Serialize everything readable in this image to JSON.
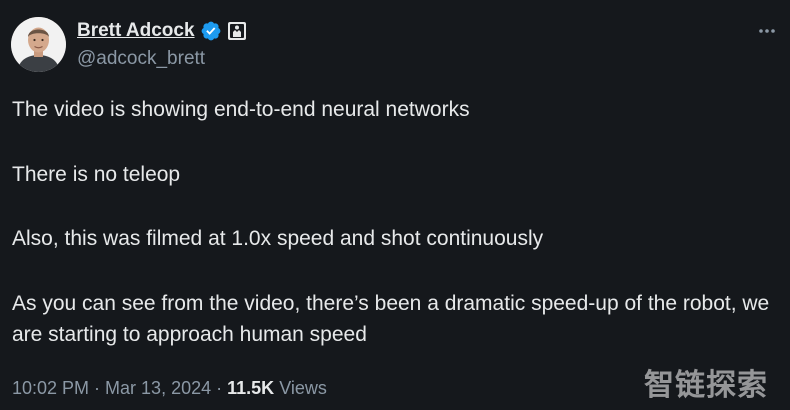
{
  "author": {
    "display_name": "Brett Adcock",
    "handle": "@adcock_brett"
  },
  "badges": {
    "verified_icon": "verified-icon",
    "affiliate_icon": "affiliate-badge-icon",
    "verified_color": "#1d9bf0"
  },
  "tweet": {
    "paragraphs": [
      "The video is showing end-to-end neural networks",
      "There is no teleop",
      "Also, this was filmed at 1.0x speed and shot continuously",
      "As you can see from the video, there’s been a dramatic speed-up of the robot, we are starting to approach human speed"
    ]
  },
  "meta": {
    "time": "10:02 PM",
    "separator": "·",
    "date": "Mar 13, 2024",
    "views_count": "11.5K",
    "views_label": "Views"
  },
  "watermark": "智链探索",
  "icons": {
    "more": "more-horizontal-icon"
  }
}
